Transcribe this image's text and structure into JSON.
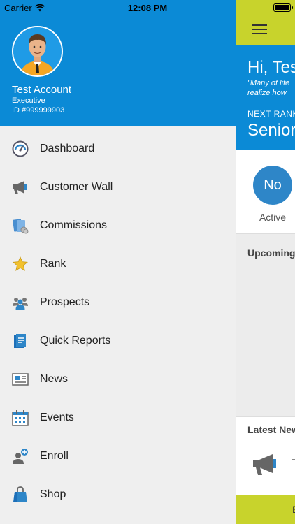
{
  "status_bar": {
    "carrier": "Carrier",
    "time": "12:08 PM"
  },
  "profile": {
    "name": "Test Account",
    "role": "Executive",
    "id": "ID #999999903"
  },
  "menu": [
    {
      "label": "Dashboard",
      "icon": "dashboard-icon"
    },
    {
      "label": "Customer Wall",
      "icon": "megaphone-icon"
    },
    {
      "label": "Commissions",
      "icon": "commissions-icon"
    },
    {
      "label": "Rank",
      "icon": "star-icon"
    },
    {
      "label": "Prospects",
      "icon": "prospects-icon"
    },
    {
      "label": "Quick Reports",
      "icon": "report-icon"
    },
    {
      "label": "News",
      "icon": "news-icon"
    },
    {
      "label": "Events",
      "icon": "calendar-icon"
    },
    {
      "label": "Enroll",
      "icon": "enroll-icon"
    },
    {
      "label": "Shop",
      "icon": "shopping-bag-icon"
    }
  ],
  "main": {
    "greeting": "Hi, Tes",
    "quote_line1": "\"Many of life",
    "quote_line2": "realize how",
    "next_rank_label": "NEXT RANK",
    "next_rank_value": "Senior",
    "active_circle": "No",
    "active_label": "Active",
    "upcoming": "Upcoming",
    "latest_news": "Latest New",
    "bottom_peek": "E"
  },
  "colors": {
    "accent_blue": "#0b8ad6",
    "lime": "#c8d32c",
    "circle_blue": "#2e86c8"
  }
}
